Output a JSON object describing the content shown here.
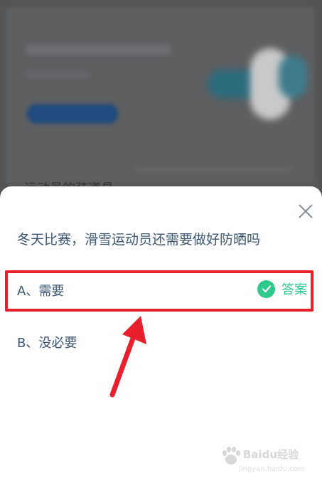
{
  "background": {
    "peek_text": "运动员的装道具"
  },
  "dialog": {
    "question": "冬天比赛，滑雪运动员还需要做好防晒吗",
    "close_icon": "close-icon",
    "options": [
      {
        "label": "A、需要",
        "is_answer": true
      },
      {
        "label": "B、没必要",
        "is_answer": false
      }
    ],
    "answer_label": "答案",
    "answer_icon": "check-circle-icon"
  },
  "annotation": {
    "highlight_color": "#e8202e",
    "arrow_color": "#e8202e"
  },
  "watermark": {
    "brand": "Baidu经验",
    "url": "jingyan.baidu.com"
  },
  "colors": {
    "text": "#3e5672",
    "accent_green": "#2fc98e"
  }
}
